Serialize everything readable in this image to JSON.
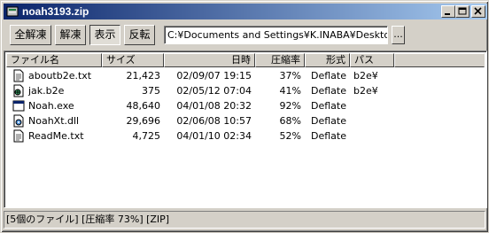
{
  "window": {
    "title": "noah3193.zip"
  },
  "toolbar": {
    "buttons": [
      {
        "label": "全解凍"
      },
      {
        "label": "解凍"
      },
      {
        "label": "表示"
      },
      {
        "label": "反転"
      }
    ],
    "path": "C:¥Documents and Settings¥K.INABA¥Desktop¥r",
    "browse_label": "..."
  },
  "list": {
    "columns": [
      "ファイル名",
      "サイズ",
      "日時",
      "圧縮率",
      "形式",
      "パス"
    ],
    "rows": [
      {
        "name": "aboutb2e.txt",
        "size": "21,423",
        "date": "02/09/07 19:15",
        "ratio": "37%",
        "method": "Deflate",
        "path": "b2e¥",
        "icon": "text-file-icon"
      },
      {
        "name": "jak.b2e",
        "size": "375",
        "date": "02/05/12 07:04",
        "ratio": "41%",
        "method": "Deflate",
        "path": "b2e¥",
        "icon": "script-file-icon"
      },
      {
        "name": "Noah.exe",
        "size": "48,640",
        "date": "04/01/08 20:32",
        "ratio": "92%",
        "method": "Deflate",
        "path": "",
        "icon": "exe-file-icon"
      },
      {
        "name": "NoahXt.dll",
        "size": "29,696",
        "date": "02/06/08 10:57",
        "ratio": "68%",
        "method": "Deflate",
        "path": "",
        "icon": "dll-file-icon"
      },
      {
        "name": "ReadMe.txt",
        "size": "4,725",
        "date": "04/01/10 02:34",
        "ratio": "52%",
        "method": "Deflate",
        "path": "",
        "icon": "text-file-icon"
      }
    ]
  },
  "status": {
    "text": "[5個のファイル] [圧縮率 73%] [ZIP]"
  }
}
